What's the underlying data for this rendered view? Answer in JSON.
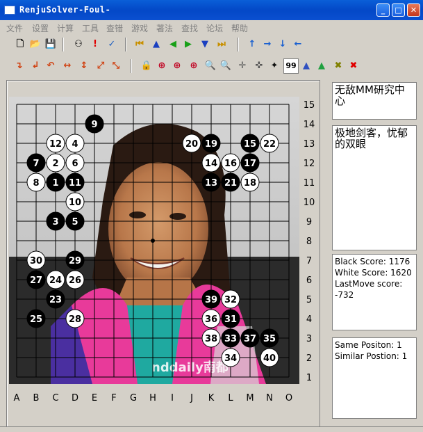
{
  "window": {
    "title": "RenjuSolver-Foul-"
  },
  "menu": [
    "文件",
    "设置",
    "计算",
    "工具",
    "查错",
    "游戏",
    "著法",
    "查找",
    "论坛",
    "帮助"
  ],
  "toolbar1": [
    {
      "name": "new-icon",
      "glyph": "🗋"
    },
    {
      "name": "open-icon",
      "glyph": "📂"
    },
    {
      "name": "save-icon",
      "glyph": "💾"
    },
    {
      "name": "stones-icon",
      "glyph": "⚇"
    },
    {
      "name": "warning-icon",
      "glyph": "!"
    },
    {
      "name": "check-icon",
      "glyph": "✓"
    },
    {
      "name": "first-move-icon",
      "glyph": "⏮"
    },
    {
      "name": "up-icon",
      "glyph": "▲"
    },
    {
      "name": "prev-icon",
      "glyph": "◀"
    },
    {
      "name": "next-icon",
      "glyph": "▶"
    },
    {
      "name": "down-icon",
      "glyph": "▼"
    },
    {
      "name": "last-move-icon",
      "glyph": "⏭"
    },
    {
      "name": "arrow-up-icon",
      "glyph": "↑"
    },
    {
      "name": "arrow-right-icon",
      "glyph": "→"
    },
    {
      "name": "arrow-down-icon",
      "glyph": "↓"
    },
    {
      "name": "arrow-left-icon",
      "glyph": "←"
    }
  ],
  "toolbar2": [
    {
      "name": "rotate-right-icon",
      "glyph": "↴"
    },
    {
      "name": "rotate-left-icon",
      "glyph": "↲"
    },
    {
      "name": "rotate-180-icon",
      "glyph": "↶"
    },
    {
      "name": "flip-horizontal-icon",
      "glyph": "↔"
    },
    {
      "name": "flip-vertical-icon",
      "glyph": "↕"
    },
    {
      "name": "flip-diagonal-icon",
      "glyph": "⤢"
    },
    {
      "name": "flip-antidiagonal-icon",
      "glyph": "⤡"
    },
    {
      "name": "lock-icon",
      "glyph": "🔒"
    },
    {
      "name": "zoom-a-icon",
      "glyph": "⊕"
    },
    {
      "name": "zoom-b-icon",
      "glyph": "⊕"
    },
    {
      "name": "zoom-c-icon",
      "glyph": "⊕"
    },
    {
      "name": "zoom-in-icon",
      "glyph": "🔍"
    },
    {
      "name": "zoom-out-icon",
      "glyph": "🔍"
    },
    {
      "name": "crosshair-icon",
      "glyph": "✛"
    },
    {
      "name": "dotted-cross-icon",
      "glyph": "✜"
    },
    {
      "name": "target-icon",
      "glyph": "✦"
    },
    {
      "name": "number-99-icon",
      "glyph": "99"
    },
    {
      "name": "pyramid-blue-icon",
      "glyph": "▲"
    },
    {
      "name": "pyramid-green-icon",
      "glyph": "▲"
    },
    {
      "name": "cross-olive-icon",
      "glyph": "✖"
    },
    {
      "name": "cross-red-icon",
      "glyph": "✖"
    }
  ],
  "board": {
    "col_labels": [
      "A",
      "B",
      "C",
      "D",
      "E",
      "F",
      "G",
      "H",
      "I",
      "J",
      "K",
      "L",
      "M",
      "N",
      "O"
    ],
    "row_labels": [
      "15",
      "14",
      "13",
      "12",
      "11",
      "10",
      "9",
      "8",
      "7",
      "6",
      "5",
      "4",
      "3",
      "2",
      "1"
    ],
    "stones": [
      {
        "n": "1",
        "color": "black",
        "pos": "C11"
      },
      {
        "n": "2",
        "color": "white",
        "pos": "C12"
      },
      {
        "n": "3",
        "color": "black",
        "pos": "C9"
      },
      {
        "n": "4",
        "color": "white",
        "pos": "D13"
      },
      {
        "n": "5",
        "color": "black",
        "pos": "D9"
      },
      {
        "n": "6",
        "color": "white",
        "pos": "D12"
      },
      {
        "n": "7",
        "color": "black",
        "pos": "B12"
      },
      {
        "n": "8",
        "color": "white",
        "pos": "B11"
      },
      {
        "n": "9",
        "color": "black",
        "pos": "E14"
      },
      {
        "n": "10",
        "color": "white",
        "pos": "D10"
      },
      {
        "n": "11",
        "color": "black",
        "pos": "D11"
      },
      {
        "n": "12",
        "color": "white",
        "pos": "C13"
      },
      {
        "n": "13",
        "color": "black",
        "pos": "K11"
      },
      {
        "n": "14",
        "color": "white",
        "pos": "K12"
      },
      {
        "n": "15",
        "color": "black",
        "pos": "M13"
      },
      {
        "n": "16",
        "color": "white",
        "pos": "L12"
      },
      {
        "n": "17",
        "color": "black",
        "pos": "M12"
      },
      {
        "n": "18",
        "color": "white",
        "pos": "M11"
      },
      {
        "n": "19",
        "color": "black",
        "pos": "K13"
      },
      {
        "n": "20",
        "color": "white",
        "pos": "J13"
      },
      {
        "n": "21",
        "color": "black",
        "pos": "L11"
      },
      {
        "n": "22",
        "color": "white",
        "pos": "N13"
      },
      {
        "n": "23",
        "color": "black",
        "pos": "C5"
      },
      {
        "n": "24",
        "color": "white",
        "pos": "C6"
      },
      {
        "n": "25",
        "color": "black",
        "pos": "B4"
      },
      {
        "n": "26",
        "color": "white",
        "pos": "D6"
      },
      {
        "n": "27",
        "color": "black",
        "pos": "B6"
      },
      {
        "n": "28",
        "color": "white",
        "pos": "D4"
      },
      {
        "n": "29",
        "color": "black",
        "pos": "D7"
      },
      {
        "n": "30",
        "color": "white",
        "pos": "B7"
      },
      {
        "n": "31",
        "color": "black",
        "pos": "L4"
      },
      {
        "n": "32",
        "color": "white",
        "pos": "L5"
      },
      {
        "n": "33",
        "color": "black",
        "pos": "L3"
      },
      {
        "n": "34",
        "color": "white",
        "pos": "L2"
      },
      {
        "n": "35",
        "color": "black",
        "pos": "N3"
      },
      {
        "n": "36",
        "color": "white",
        "pos": "K4"
      },
      {
        "n": "37",
        "color": "black",
        "pos": "M3"
      },
      {
        "n": "38",
        "color": "white",
        "pos": "K3"
      },
      {
        "n": "39",
        "color": "black",
        "pos": "K5"
      },
      {
        "n": "40",
        "color": "white",
        "pos": "N2"
      }
    ]
  },
  "side": {
    "title": "无敌MM研究中心",
    "comment": "极地剑客，忧郁的双眼",
    "black_score": "Black Score: 1176",
    "white_score": "White Score: 1620",
    "last_move_label": "LastMove score:",
    "last_move_value": "-732",
    "same_position": "Same Positon: 1",
    "similar_position": "Similar Postion: 1"
  },
  "watermark": "nddaily南都"
}
